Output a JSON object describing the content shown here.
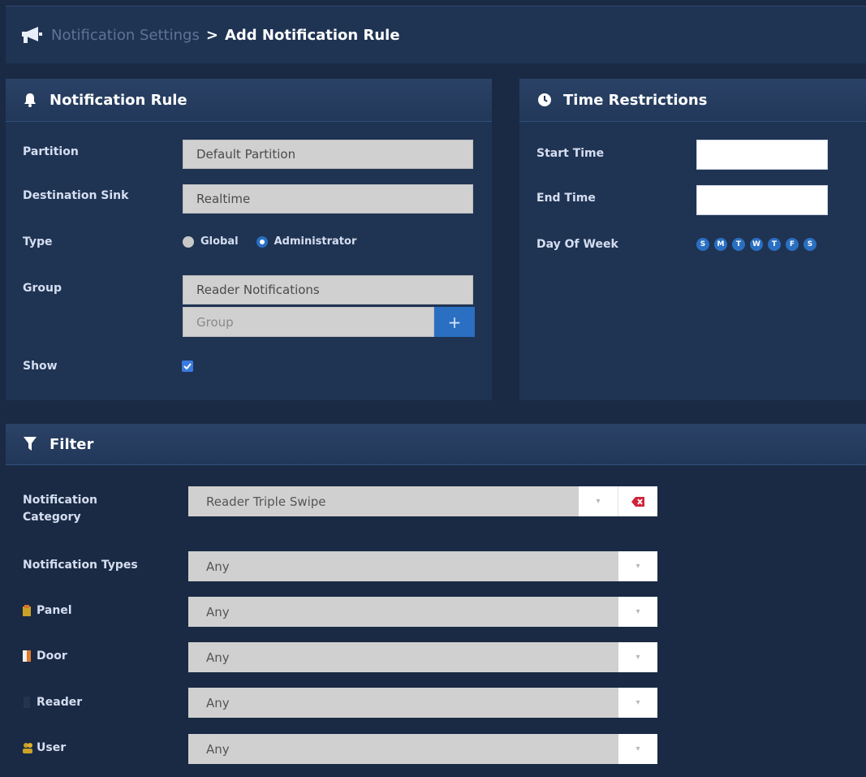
{
  "breadcrumb": {
    "parent": "Notification Settings",
    "separator": ">",
    "current": "Add Notification Rule"
  },
  "rule_panel": {
    "title": "Notification Rule",
    "partition_label": "Partition",
    "partition_value": "Default Partition",
    "sink_label": "Destination Sink",
    "sink_value": "Realtime",
    "type_label": "Type",
    "type_options": [
      "Global",
      "Administrator"
    ],
    "type_selected": "Administrator",
    "group_label": "Group",
    "group_value": "Reader Notifications",
    "group_placeholder": "Group",
    "add_group": "+",
    "show_label": "Show",
    "show_checked": true
  },
  "time_panel": {
    "title": "Time Restrictions",
    "start_label": "Start Time",
    "start_value": "",
    "end_label": "End Time",
    "end_value": "",
    "dow_label": "Day Of Week",
    "days": [
      "S",
      "M",
      "T",
      "W",
      "T",
      "F",
      "S"
    ]
  },
  "filter_panel": {
    "title": "Filter",
    "category_label_line1": "Notification",
    "category_label_line2": "Category",
    "category_value": "Reader Triple Swipe",
    "types_label": "Notification Types",
    "types_value": "Any",
    "panel_label": "Panel",
    "panel_value": "Any",
    "door_label": "Door",
    "door_value": "Any",
    "reader_label": "Reader",
    "reader_value": "Any",
    "user_label": "User",
    "user_value": "Any"
  },
  "colors": {
    "background": "#1a2a44",
    "panel": "#1f3353",
    "accent": "#2a6fc2",
    "clear": "#d0233a"
  },
  "icons": {
    "breadcrumb": "megaphone-icon",
    "rule": "bell-icon",
    "time": "clock-icon",
    "filter": "funnel-icon",
    "panel": "panel-icon",
    "door": "door-icon",
    "reader": "reader-icon",
    "user": "user-icon"
  }
}
